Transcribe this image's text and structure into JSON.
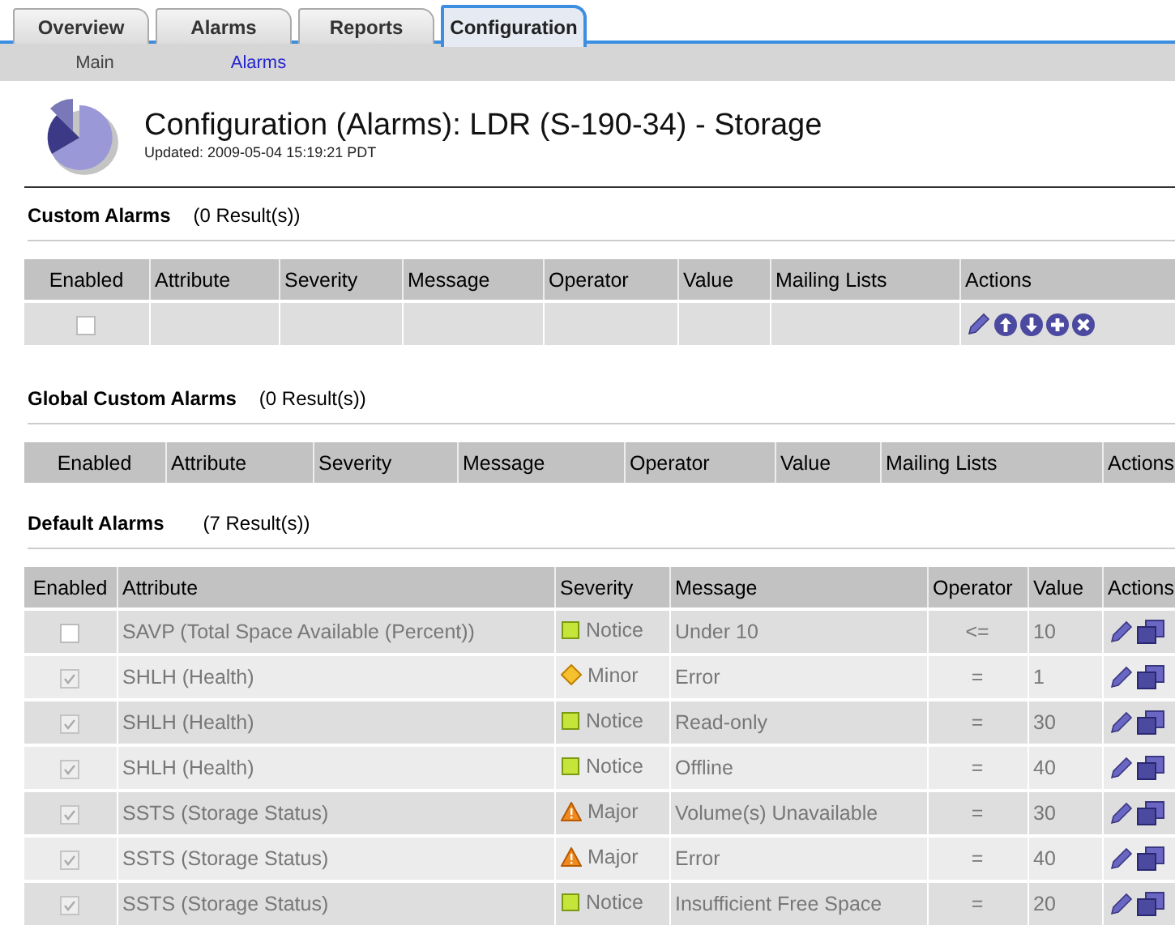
{
  "tabs": [
    {
      "label": "Overview",
      "selected": false
    },
    {
      "label": "Alarms",
      "selected": false
    },
    {
      "label": "Reports",
      "selected": false
    },
    {
      "label": "Configuration",
      "selected": true
    }
  ],
  "subnav": [
    {
      "label": "Main",
      "selected": false
    },
    {
      "label": "Alarms",
      "selected": true
    }
  ],
  "header": {
    "title": "Configuration (Alarms): LDR (S-190-34) - Storage",
    "updated": "Updated: 2009-05-04 15:19:21 PDT"
  },
  "custom_alarms": {
    "title": "Custom Alarms",
    "count": "(0 Result(s))",
    "columns": [
      "Enabled",
      "Attribute",
      "Severity",
      "Message",
      "Operator",
      "Value",
      "Mailing Lists",
      "Actions"
    ],
    "rows": [
      {
        "checked": false
      }
    ]
  },
  "global_custom_alarms": {
    "title": "Global Custom Alarms",
    "count": "(0 Result(s))",
    "columns": [
      "Enabled",
      "Attribute",
      "Severity",
      "Message",
      "Operator",
      "Value",
      "Mailing Lists",
      "Actions"
    ]
  },
  "default_alarms": {
    "title": "Default Alarms",
    "count": "(7 Result(s))",
    "columns": [
      "Enabled",
      "Attribute",
      "Severity",
      "Message",
      "Operator",
      "Value",
      "Actions"
    ],
    "rows": [
      {
        "checked": false,
        "disabled": false,
        "attribute": "SAVP (Total Space Available (Percent))",
        "kind": "notice",
        "severity": "Notice",
        "message": "Under 10",
        "operator": "<=",
        "value": "10"
      },
      {
        "checked": true,
        "disabled": true,
        "attribute": "SHLH (Health)",
        "kind": "minor",
        "severity": "Minor",
        "message": "Error",
        "operator": "=",
        "value": "1"
      },
      {
        "checked": true,
        "disabled": true,
        "attribute": "SHLH (Health)",
        "kind": "notice",
        "severity": "Notice",
        "message": "Read-only",
        "operator": "=",
        "value": "30"
      },
      {
        "checked": true,
        "disabled": true,
        "attribute": "SHLH (Health)",
        "kind": "notice",
        "severity": "Notice",
        "message": "Offline",
        "operator": "=",
        "value": "40"
      },
      {
        "checked": true,
        "disabled": true,
        "attribute": "SSTS (Storage Status)",
        "kind": "major",
        "severity": "Major",
        "message": "Volume(s) Unavailable",
        "operator": "=",
        "value": "30"
      },
      {
        "checked": true,
        "disabled": true,
        "attribute": "SSTS (Storage Status)",
        "kind": "major",
        "severity": "Major",
        "message": "Error",
        "operator": "=",
        "value": "40"
      },
      {
        "checked": true,
        "disabled": true,
        "attribute": "SSTS (Storage Status)",
        "kind": "notice",
        "severity": "Notice",
        "message": "Insufficient Free Space",
        "operator": "=",
        "value": "20"
      }
    ]
  }
}
